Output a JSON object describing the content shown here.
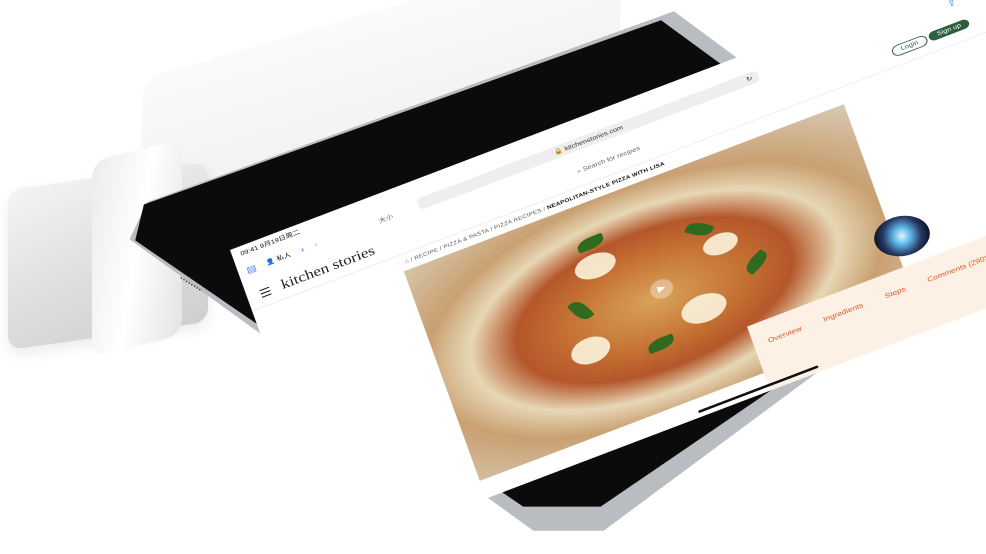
{
  "status": {
    "time": "09:41",
    "date": "9月19日周二"
  },
  "browser": {
    "tab_label": "大小",
    "url": "kitchenstories.com",
    "private_label": "私人"
  },
  "site": {
    "logo": "kitchen stories",
    "search_placeholder": "Search for recipes",
    "login": "Login",
    "signup": "Sign up"
  },
  "breadcrumb": {
    "path": "/ RECIPE / PIZZA & PASTA / PIZZA RECIPES / ",
    "current": "NEAPOLITAN-STYLE PIZZA WITH LISA"
  },
  "recipe_tabs": [
    "Overview",
    "Ingredients",
    "Steps",
    "Comments (290)"
  ],
  "colors": {
    "accent_green": "#2c5f3e",
    "tab_orange": "#e0572b",
    "panel_peach": "#fdf1e6",
    "ios_blue": "#2f7bf6"
  },
  "icons": [
    "sidebar-icon",
    "back-icon",
    "forward-icon",
    "share-icon",
    "add-tab-icon",
    "tabs-icon",
    "reload-icon",
    "search-icon",
    "home-icon",
    "hamburger-icon",
    "play-icon",
    "siri-icon"
  ]
}
